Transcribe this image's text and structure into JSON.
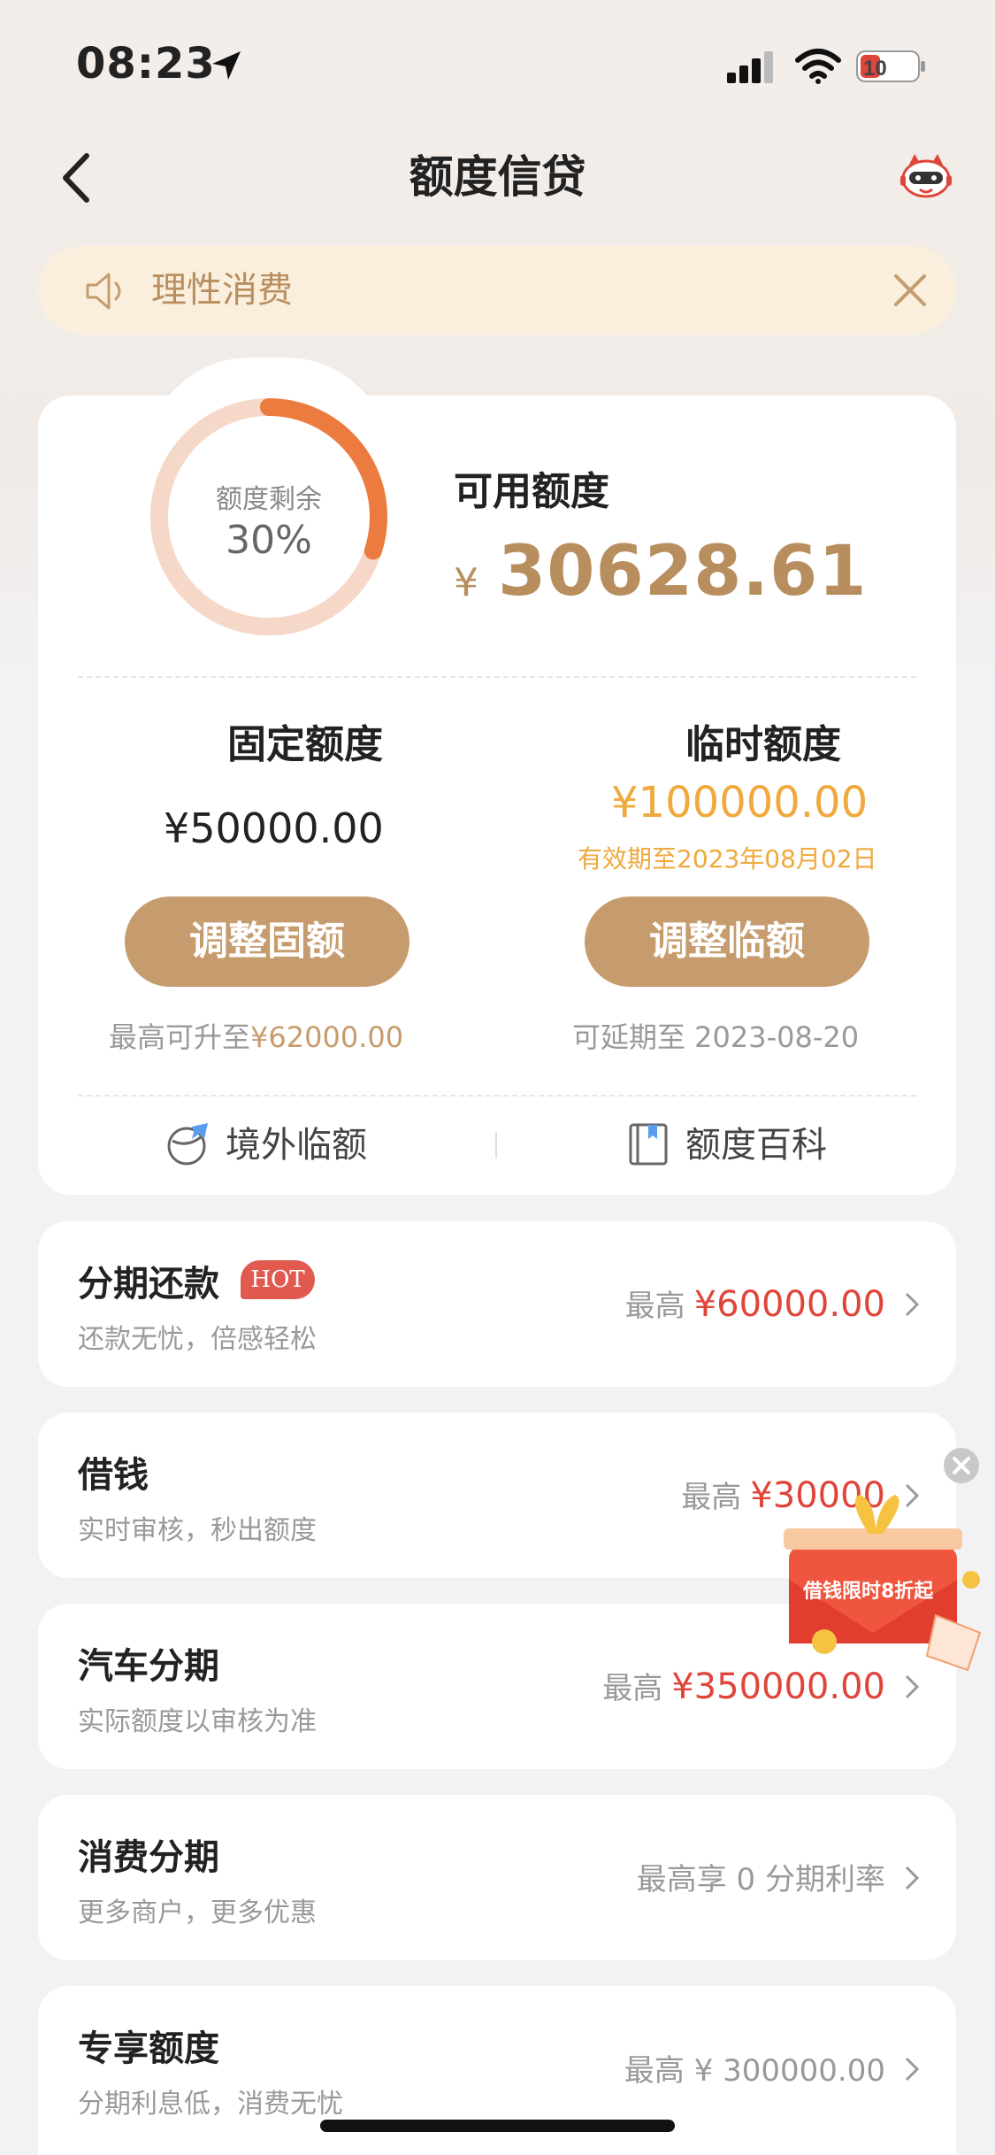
{
  "status_bar": {
    "time": "08:23",
    "battery": "10"
  },
  "nav": {
    "title": "额度信贷"
  },
  "notice": {
    "text": "理性消费"
  },
  "credit": {
    "donut_label": "额度剩余",
    "remaining_percent": "30%",
    "remaining_fraction": 0.3,
    "available_label": "可用额度",
    "available_currency": "¥",
    "available_amount": "30628.61"
  },
  "fixed": {
    "title": "固定额度",
    "amount": "¥50000.00",
    "button": "调整固额",
    "note_prefix": "最高可升至",
    "note_value": "¥62000.00"
  },
  "temporary": {
    "title": "临时额度",
    "amount": "¥100000.00",
    "expire": "有效期至2023年08月02日",
    "button": "调整临额",
    "note": "可延期至 2023-08-20"
  },
  "links": [
    {
      "label": "境外临额",
      "icon": "globe-plane-icon"
    },
    {
      "label": "额度百科",
      "icon": "book-icon"
    }
  ],
  "list": [
    {
      "title": "分期还款",
      "badge": "HOT",
      "subtitle": "还款无忧，倍感轻松",
      "right_prefix": "最高",
      "right_value": "¥60000.00"
    },
    {
      "title": "借钱",
      "subtitle": "实时审核，秒出额度",
      "right_prefix": "最高",
      "right_value": "¥30000"
    },
    {
      "title": "汽车分期",
      "subtitle": "实际额度以审核为准",
      "right_prefix": "最高",
      "right_value": "¥350000.00"
    },
    {
      "title": "消费分期",
      "subtitle": "更多商户，更多优惠",
      "right_text": "最高享 0 分期利率"
    },
    {
      "title": "专享额度",
      "subtitle": "分期利息低，消费无忧",
      "right_text": "最高 ¥ 300000.00"
    }
  ],
  "promo": {
    "text": "借钱限时8折起"
  },
  "colors": {
    "accent_gold": "#c69c6e",
    "donut_arc": "#ec7b3f",
    "donut_track": "#f6d8c9",
    "temp_orange": "#efa93c",
    "price_red": "#e0453b"
  }
}
